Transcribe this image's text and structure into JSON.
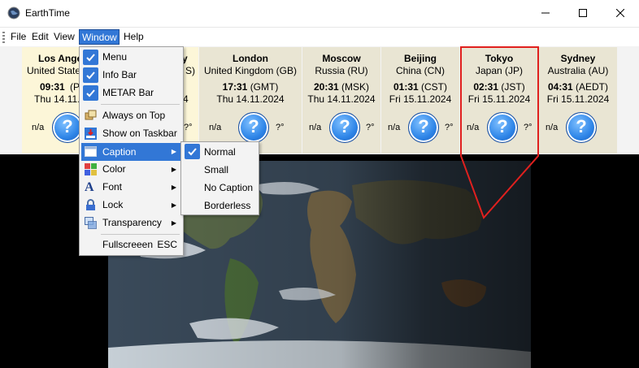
{
  "window": {
    "title": "EarthTime"
  },
  "menubar": {
    "items": [
      "File",
      "Edit",
      "View",
      "Window",
      "Help"
    ]
  },
  "cities": [
    {
      "name": "Los Angeles",
      "country": "United States (US)",
      "time": "09:31",
      "zone": "(PST)",
      "date": "Thu 14.11.2024",
      "weather": "n/a",
      "temp": "?°"
    },
    {
      "name": "London",
      "country": "United Kingdom (GB)",
      "time": "17:31",
      "zone": "(GMT)",
      "date": "Thu 14.11.2024",
      "weather": "n/a",
      "temp": "?°"
    },
    {
      "name": "Moscow",
      "country": "Russia (RU)",
      "time": "20:31",
      "zone": "(MSK)",
      "date": "Thu 14.11.2024",
      "weather": "n/a",
      "temp": "?°"
    },
    {
      "name": "Beijing",
      "country": "China (CN)",
      "time": "01:31",
      "zone": "(CST)",
      "date": "Fri 15.11.2024",
      "weather": "n/a",
      "temp": "?°"
    },
    {
      "name": "Tokyo",
      "country": "Japan (JP)",
      "time": "02:31",
      "zone": "(JST)",
      "date": "Fri 15.11.2024",
      "weather": "n/a",
      "temp": "?°"
    },
    {
      "name": "Sydney",
      "country": "Australia (AU)",
      "time": "04:31",
      "zone": "(AEDT)",
      "date": "Fri 15.11.2024",
      "weather": "n/a",
      "temp": "?°"
    }
  ],
  "la_clip": {
    "name": "Los Ange",
    "country": "United State",
    "time_prefix": "09:31",
    "zone_frag": "(PS",
    "date_frag": "Thu 14.11."
  },
  "window_menu": {
    "menu": "Menu",
    "info_bar": "Info Bar",
    "metar_bar": "METAR Bar",
    "always_on_top": "Always on Top",
    "show_on_taskbar": "Show on Taskbar",
    "caption": "Caption",
    "color": "Color",
    "font": "Font",
    "lock": "Lock",
    "transparency": "Transparency",
    "fullscreen": "Fullscreeen",
    "fullscreen_shortcut": "ESC"
  },
  "caption_submenu": {
    "normal": "Normal",
    "small": "Small",
    "no_caption": "No Caption",
    "borderless": "Borderless"
  },
  "colors": {
    "accent": "#3277d6",
    "highlight_border": "#e0201e",
    "city_bg": "#e9e5d3",
    "la_bg": "#fcf6d8"
  },
  "peek": {
    "london_clip": "y",
    "london_zone_clip": "S)",
    "london_time_clip": "4",
    "london_temp_clip": "?°"
  }
}
